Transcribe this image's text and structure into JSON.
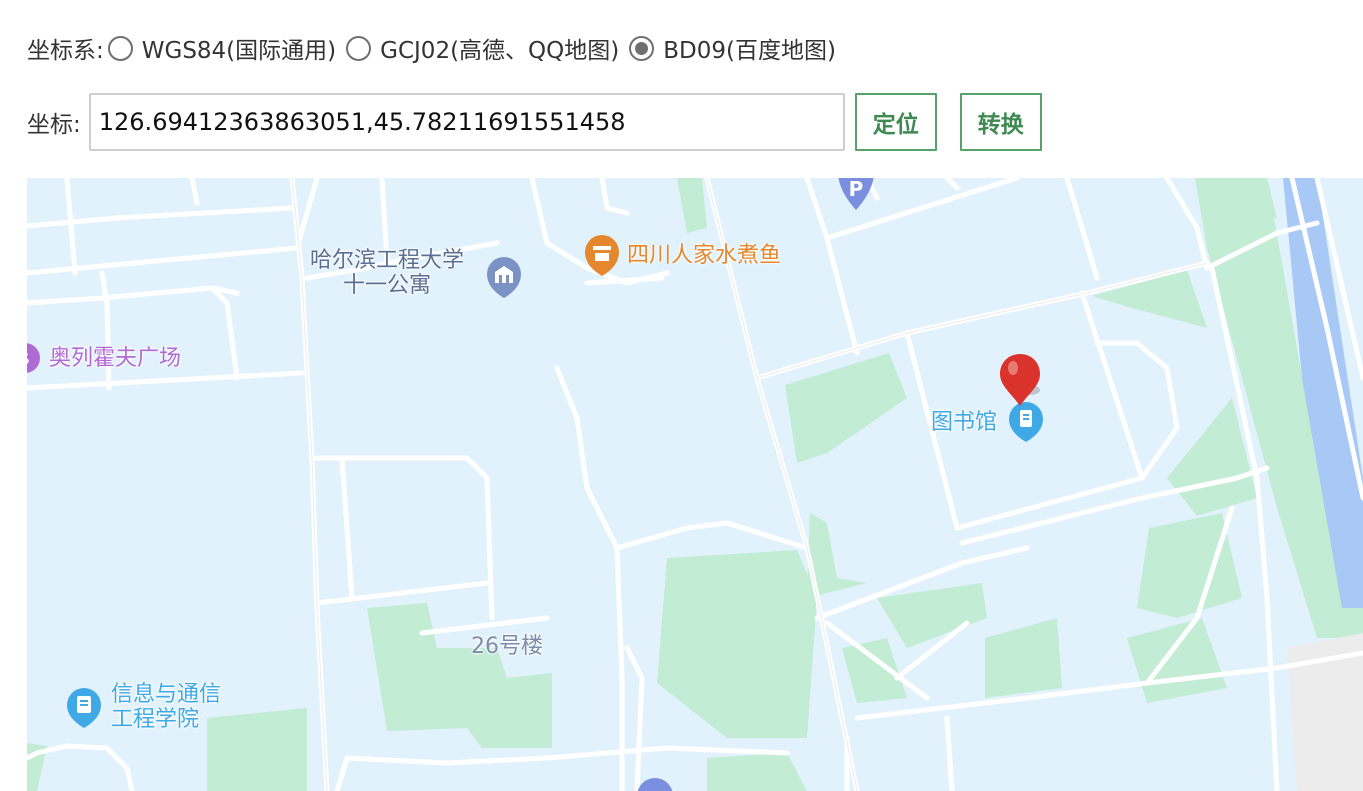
{
  "coord_system": {
    "label": "坐标系:",
    "options": [
      {
        "label": "WGS84(国际通用)",
        "checked": false
      },
      {
        "label": "GCJ02(高德、QQ地图)",
        "checked": false
      },
      {
        "label": "BD09(百度地图)",
        "checked": true
      }
    ]
  },
  "coords": {
    "label": "坐标:",
    "value": "126.69412363863051,45.78211691551458"
  },
  "buttons": {
    "locate": "定位",
    "convert": "转换"
  },
  "map": {
    "pois": {
      "apartment_line1": "哈尔滨工程大学",
      "apartment_line2": "十一公寓",
      "restaurant": "四川人家水煮鱼",
      "plaza": "奥列霍夫广场",
      "library": "图书馆",
      "building26": "26号楼",
      "school_line1": "信息与通信",
      "school_line2": "工程学院"
    },
    "colors": {
      "background": "#e2f2fc",
      "road": "#ffffff",
      "green": "#c2ecd3",
      "water": "#a8c8f5",
      "poi_edu": "#5b7fb0",
      "poi_food": "#e4872e",
      "poi_shop": "#b06ad6",
      "poi_library": "#3fa9e6",
      "marker": "#d9332b"
    },
    "icons": [
      "parking-icon",
      "school-icon",
      "restaurant-icon",
      "shopping-icon",
      "library-icon",
      "map-marker-icon"
    ]
  }
}
